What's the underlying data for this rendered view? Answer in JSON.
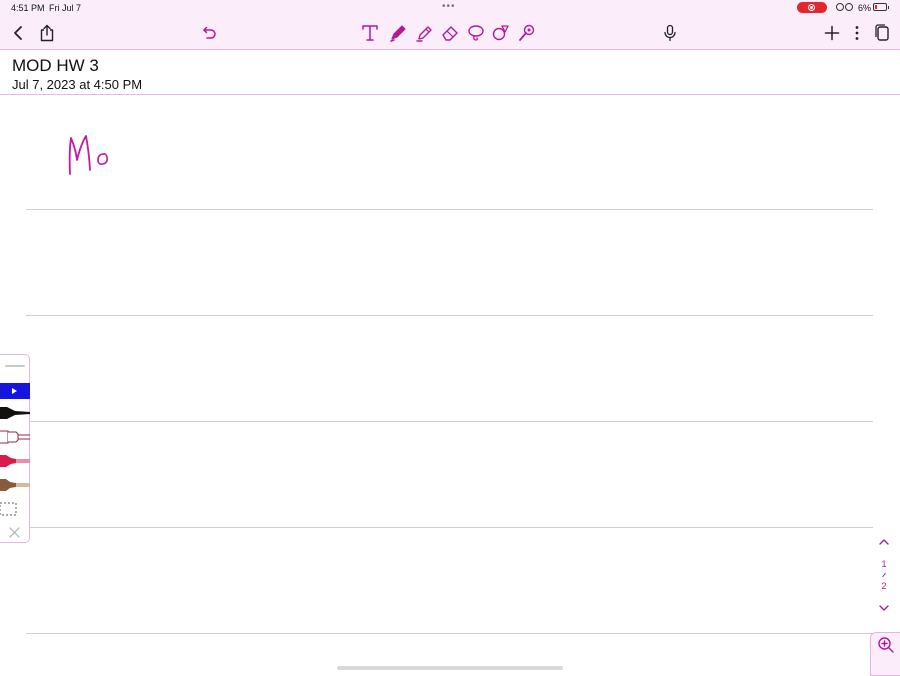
{
  "status_bar": {
    "time": "4:51 PM",
    "date": "Fri Jul 7",
    "battery_percent": "6%"
  },
  "note": {
    "title": "MOD HW 3",
    "date": "Jul 7, 2023 at 4:50 PM",
    "handwriting": "Mo"
  },
  "page_indicator": {
    "current": "1",
    "total": "2"
  },
  "icons": {
    "back": "chevron-left-icon",
    "share": "share-icon",
    "undo": "undo-icon",
    "text": "text-tool-icon",
    "pen": "pen-tool-icon",
    "highlighter": "highlighter-tool-icon",
    "eraser": "eraser-tool-icon",
    "lasso": "lasso-tool-icon",
    "shapes": "shapes-tool-icon",
    "laser": "laser-pointer-icon",
    "mic": "microphone-icon",
    "add": "plus-icon",
    "more": "more-vertical-icon",
    "pages": "pages-icon",
    "zoom": "zoom-in-icon"
  },
  "colors": {
    "accent": "#b1189a",
    "toolbar_bg": "#fbeefa",
    "ink": "#c21aa6",
    "recording": "#e2262d"
  }
}
